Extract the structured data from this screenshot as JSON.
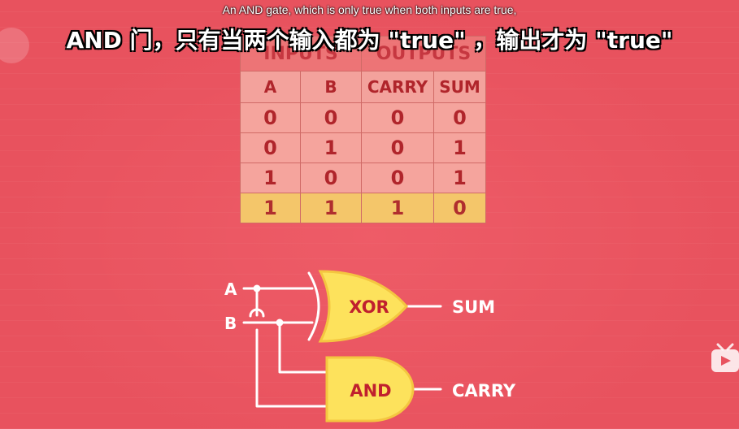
{
  "subtitle_en": "An AND gate, which is only true when both inputs are true,",
  "subtitle_zh": "AND 门，只有当两个输入都为 \"true\" ，输出才为 \"true\"",
  "table": {
    "group_headers": [
      "INPUTS",
      "OUTPUTS"
    ],
    "columns": [
      "A",
      "B",
      "CARRY",
      "SUM"
    ],
    "rows": [
      [
        "0",
        "0",
        "0",
        "0"
      ],
      [
        "0",
        "1",
        "0",
        "1"
      ],
      [
        "1",
        "0",
        "0",
        "1"
      ],
      [
        "1",
        "1",
        "1",
        "0"
      ]
    ],
    "highlighted_row": 3
  },
  "circuit": {
    "input_a": "A",
    "input_b": "B",
    "xor_gate": "XOR",
    "and_gate": "AND",
    "output_sum": "SUM",
    "output_carry": "CARRY"
  },
  "colors": {
    "background": "#e8525e",
    "gate_fill": "#fde25c",
    "gate_stroke": "#f4c640",
    "table_cell": "#f5a49d",
    "table_highlight": "#f4c66a"
  }
}
